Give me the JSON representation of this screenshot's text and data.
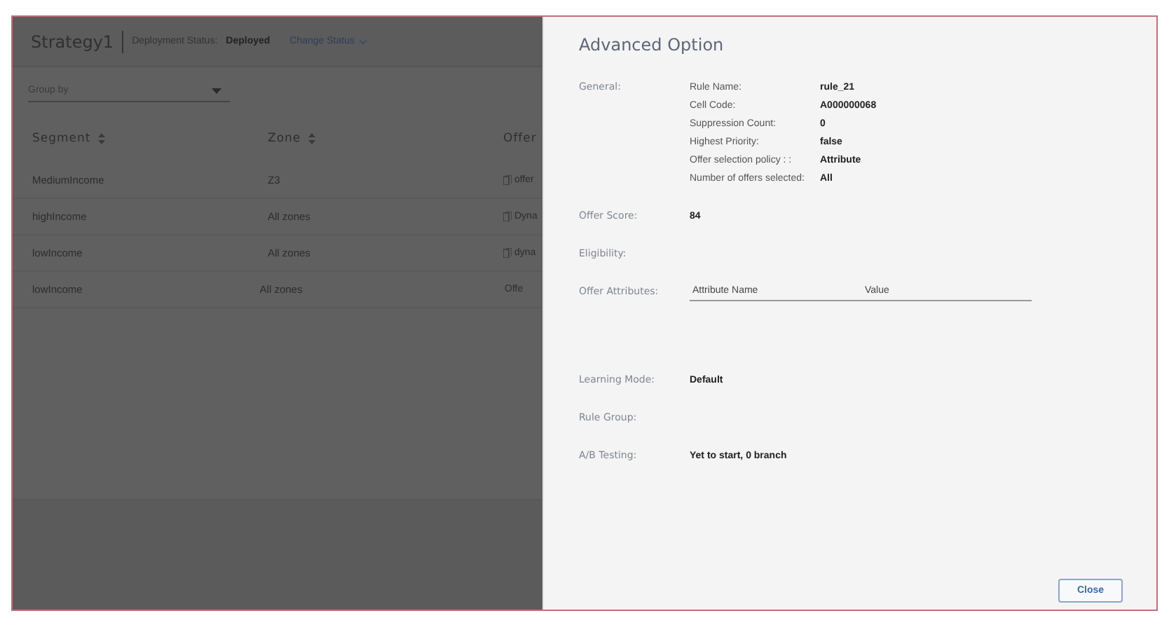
{
  "page": {
    "title": "Strategy1",
    "status_label": "Deployment Status:",
    "status_value": "Deployed",
    "change_status": "Change Status",
    "group_by": {
      "placeholder": "Group by"
    },
    "columns": [
      "Segment",
      "Zone",
      "Offer"
    ],
    "rows": [
      {
        "segment": "MediumIncome",
        "zone": "Z3",
        "offer": "offer",
        "offer_icon": true
      },
      {
        "segment": "highIncome",
        "zone": "All zones",
        "offer": "Dyna",
        "offer_icon": true
      },
      {
        "segment": "lowIncome",
        "zone": "All zones",
        "offer": "dyna",
        "offer_icon": true
      },
      {
        "segment": "lowIncome",
        "zone": "All zones",
        "offer": "Offe",
        "offer_icon": false
      }
    ]
  },
  "dialog": {
    "title": "Advanced Option",
    "sections": [
      {
        "kind": "pairs",
        "label": "General:",
        "pairs": [
          {
            "name": "Rule Name:",
            "value": "rule_21"
          },
          {
            "name": "Cell Code:",
            "value": "A000000068"
          },
          {
            "name": "Suppression Count:",
            "value": "0"
          },
          {
            "name": "Highest Priority:",
            "value": "false"
          },
          {
            "name": "Offer selection policy : :",
            "value": "Attribute"
          },
          {
            "name": "Number of offers selected:",
            "value": "All"
          }
        ]
      },
      {
        "kind": "value",
        "label": "Offer Score:",
        "value": "84"
      },
      {
        "kind": "empty",
        "label": "Eligibility:"
      },
      {
        "kind": "table",
        "label": "Offer Attributes:",
        "columns": [
          "Attribute Name",
          "Value"
        ]
      },
      {
        "kind": "value",
        "label": "Learning Mode:",
        "value": "Default"
      },
      {
        "kind": "empty",
        "label": "Rule Group:"
      },
      {
        "kind": "value",
        "label": "A/B Testing:",
        "value": "Yet to start, 0 branch"
      }
    ],
    "close": "Close"
  }
}
